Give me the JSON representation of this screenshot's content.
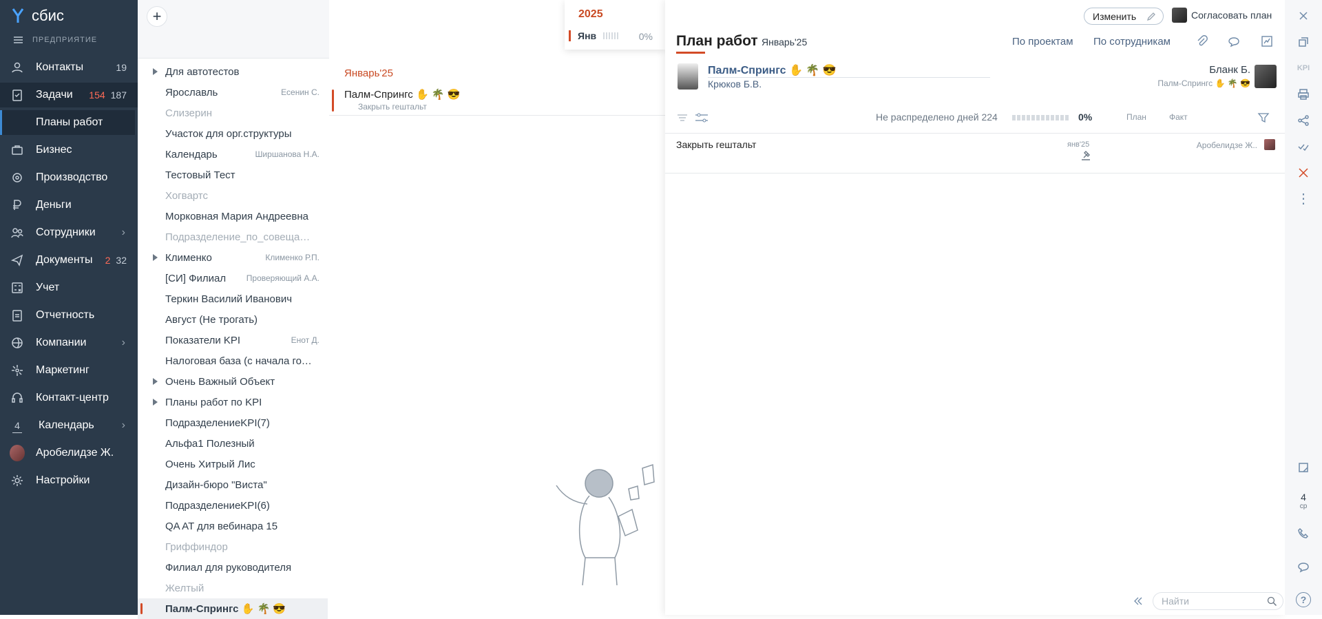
{
  "sidebar": {
    "logo": "сбис",
    "section_label": "ПРЕДПРИЯТИЕ",
    "items": [
      {
        "label": "Контакты",
        "count": "19",
        "icon": "contacts-icon"
      },
      {
        "label": "Задачи",
        "count_red": "154",
        "count": "187",
        "icon": "tasks-icon"
      },
      {
        "label": "Планы работ"
      },
      {
        "label": "Бизнес",
        "icon": "business-icon"
      },
      {
        "label": "Производство",
        "icon": "production-icon"
      },
      {
        "label": "Деньги",
        "icon": "money-icon"
      },
      {
        "label": "Сотрудники",
        "icon": "staff-icon"
      },
      {
        "label": "Документы",
        "count_red": "2",
        "count": "32",
        "icon": "documents-icon"
      },
      {
        "label": "Учет",
        "icon": "accounting-icon"
      },
      {
        "label": "Отчетность",
        "icon": "reporting-icon"
      },
      {
        "label": "Компании",
        "icon": "companies-icon"
      },
      {
        "label": "Маркетинг",
        "icon": "marketing-icon"
      },
      {
        "label": "Контакт-центр",
        "icon": "contact-center-icon"
      },
      {
        "label": "Календарь",
        "icon_text": "4"
      },
      {
        "label": "Аробелидзе Ж."
      },
      {
        "label": "Настройки",
        "icon": "settings-icon"
      }
    ]
  },
  "list": [
    {
      "name": "Для автотестов",
      "sub": "",
      "tri": true,
      "grey": false
    },
    {
      "name": "Ярославль",
      "sub": "Есенин С.",
      "tri": false,
      "grey": false
    },
    {
      "name": "Слизерин",
      "sub": "",
      "tri": false,
      "grey": true
    },
    {
      "name": "Участок для орг.структуры",
      "sub": "",
      "tri": false,
      "grey": false
    },
    {
      "name": "Календарь",
      "sub": "Ширшанова Н.А.",
      "tri": false,
      "grey": false
    },
    {
      "name": "Тестовый Тест",
      "sub": "",
      "tri": false,
      "grey": false
    },
    {
      "name": "Хогвартс",
      "sub": "",
      "tri": false,
      "grey": true
    },
    {
      "name": "Морковная Мария Андреевна",
      "sub": "",
      "tri": false,
      "grey": false
    },
    {
      "name": "Подразделение_по_совещаниям",
      "sub": "",
      "tri": false,
      "grey": true
    },
    {
      "name": "Клименко",
      "sub": "Клименко Р.П.",
      "tri": true,
      "grey": false
    },
    {
      "name": "[СИ] Филиал",
      "sub": "Проверяющий А.А.",
      "tri": false,
      "grey": false
    },
    {
      "name": "Теркин Василий Иванович",
      "sub": "",
      "tri": false,
      "grey": false
    },
    {
      "name": "Август (Не трогать)",
      "sub": "",
      "tri": false,
      "grey": false
    },
    {
      "name": "Показатели KPI",
      "sub": "Енот Д.",
      "tri": false,
      "grey": false
    },
    {
      "name": "Налоговая база (с начала года)",
      "sub": "",
      "tri": false,
      "grey": false
    },
    {
      "name": "Очень Важный Объект",
      "sub": "",
      "tri": true,
      "grey": false
    },
    {
      "name": "Планы работ по KPI",
      "sub": "",
      "tri": true,
      "grey": false
    },
    {
      "name": "ПодразделениеKPI(7)",
      "sub": "",
      "tri": false,
      "grey": false
    },
    {
      "name": "Альфа1 Полезный",
      "sub": "",
      "tri": false,
      "grey": false
    },
    {
      "name": "Очень Хитрый Лис",
      "sub": "",
      "tri": false,
      "grey": false
    },
    {
      "name": "Дизайн-бюро \"Виста\"",
      "sub": "",
      "tri": false,
      "grey": false
    },
    {
      "name": "ПодразделениеKPI(6)",
      "sub": "",
      "tri": false,
      "grey": false
    },
    {
      "name": "QA AT для вебинара 15",
      "sub": "",
      "tri": false,
      "grey": false
    },
    {
      "name": "Гриффиндор",
      "sub": "",
      "tri": false,
      "grey": true
    },
    {
      "name": "Филиал для руководителя",
      "sub": "",
      "tri": false,
      "grey": false
    },
    {
      "name": "Желтый",
      "sub": "",
      "tri": false,
      "grey": true
    },
    {
      "name": "Палм-Спрингс ✋ 🌴 😎",
      "sub": "",
      "tri": false,
      "grey": false,
      "selected": true
    }
  ],
  "middle": {
    "month_header": "Январь'25",
    "item_title": "Палм-Спрингс ✋ 🌴 😎",
    "item_sub": "Закрыть гештальт"
  },
  "month_popup": {
    "year": "2025",
    "month": "Янв",
    "percent": "0%"
  },
  "panel": {
    "edit_button": "Изменить",
    "approve_button": "Согласовать план",
    "title": "План работ",
    "period": "Январь'25",
    "tab_projects": "По проектам",
    "tab_staff": "По сотрудникам",
    "plan_name": "Палм-Спрингс ✋ 🌴 😎",
    "responsible": "Крюков Б.В.",
    "blank_name": "Бланк Б.",
    "blank_sub": "Палм-Спрингс ✋ 🌴 😎",
    "unassigned_label": "Не распределено дней 224",
    "unassigned_percent": "0%",
    "col_plan": "План",
    "col_fact": "Факт",
    "task_title": "Закрыть гештальт",
    "task_date": "янв'25",
    "task_assignee": "Аробелидзе Ж..",
    "search_placeholder": "Найти"
  },
  "toolbar": {
    "kpi": "KPI",
    "calendar_day": "4",
    "calendar_weekday": "ср",
    "help": "?"
  },
  "colors": {
    "sidebar_bg": "#2b3a4a",
    "accent_red": "#d34b27",
    "link_blue": "#3a5b85"
  }
}
